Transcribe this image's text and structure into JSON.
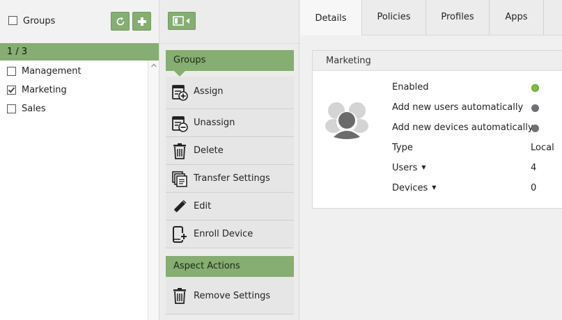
{
  "left_panel": {
    "header_title": "Groups",
    "refresh_icon": "refresh-icon",
    "add_icon": "plus-icon",
    "count_label": "1 / 3",
    "groups": [
      {
        "label": "Management",
        "checked": false
      },
      {
        "label": "Marketing",
        "checked": true
      },
      {
        "label": "Sales",
        "checked": false
      }
    ]
  },
  "middle_panel": {
    "toggle_icon": "panel-toggle-icon",
    "sections": [
      {
        "title": "Groups",
        "actions": [
          {
            "label": "Assign",
            "icon": "assign-icon"
          },
          {
            "label": "Unassign",
            "icon": "unassign-icon"
          },
          {
            "label": "Delete",
            "icon": "trash-icon"
          },
          {
            "label": "Transfer Settings",
            "icon": "transfer-settings-icon"
          },
          {
            "label": "Edit",
            "icon": "pencil-icon"
          },
          {
            "label": "Enroll Device",
            "icon": "enroll-device-icon"
          }
        ]
      },
      {
        "title": "Aspect Actions",
        "actions": [
          {
            "label": "Remove Settings",
            "icon": "trash-icon"
          }
        ]
      }
    ]
  },
  "right_panel": {
    "tabs": [
      {
        "label": "Details",
        "active": true
      },
      {
        "label": "Policies",
        "active": false
      },
      {
        "label": "Profiles",
        "active": false
      },
      {
        "label": "Apps",
        "active": false
      }
    ],
    "card": {
      "title": "Marketing",
      "avatar_icon": "group-avatar-icon",
      "properties": [
        {
          "label": "Enabled",
          "status": "on"
        },
        {
          "label": "Add new users automatically",
          "status": "off"
        },
        {
          "label": "Add new devices automatically",
          "status": "off"
        },
        {
          "label": "Type",
          "value": "Local"
        },
        {
          "label": "Users",
          "value": "4",
          "dropdown": true
        },
        {
          "label": "Devices",
          "value": "0",
          "dropdown": true
        }
      ]
    }
  },
  "colors": {
    "accent_green": "#86ad72",
    "status_on": "#7fbf3a",
    "status_off": "#6e7276"
  }
}
